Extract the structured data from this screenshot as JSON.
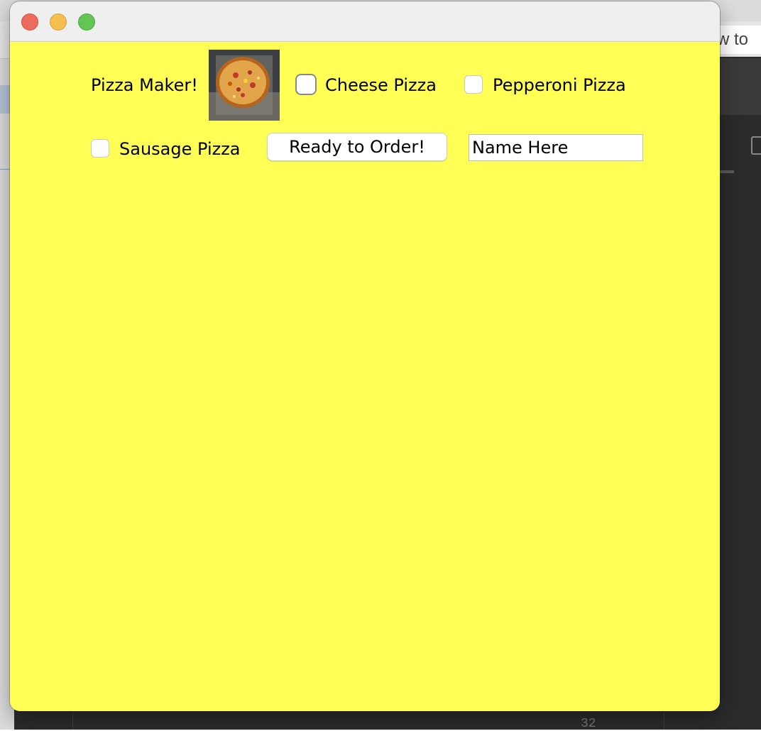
{
  "background": {
    "browser_tab_fragment": "w to",
    "gutter_number": "32"
  },
  "window": {
    "title": "",
    "background_color": "#ffff55"
  },
  "content": {
    "header_label": "Pizza Maker!",
    "pizza_image": "pizza-photo",
    "checkboxes": [
      {
        "label": "Cheese Pizza",
        "checked": false
      },
      {
        "label": "Pepperoni Pizza",
        "checked": false
      },
      {
        "label": "Sausage Pizza",
        "checked": false
      }
    ],
    "order_button_label": "Ready to Order!",
    "name_field_value": "Name Here"
  }
}
